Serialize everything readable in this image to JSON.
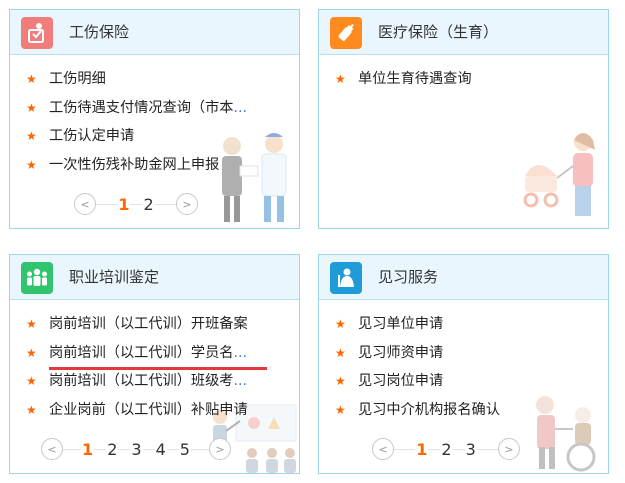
{
  "colors": {
    "panel_border": "#9ed6ea",
    "header_bg": "#eaf6fd",
    "star": "#ff6600",
    "active_page": "#ff6600",
    "link_dots": "#3b7dd8",
    "underline": "#e4393c",
    "icon_workinjury": "#f07c7c",
    "icon_medical": "#ff8a1e",
    "icon_training": "#2fc46d",
    "icon_internship": "#1f9bd7"
  },
  "panels": [
    {
      "title": "工伤保险",
      "icon": "injured-person-icon",
      "items": [
        "工伤明细",
        "工伤待遇支付情况查询（市本",
        "工伤认定申请",
        "一次性伤残补助金网上申报"
      ],
      "items_truncated": [
        false,
        true,
        false,
        false
      ],
      "pager": {
        "pages": [
          "1",
          "2"
        ],
        "active": "1",
        "prev": "<",
        "next": ">"
      }
    },
    {
      "title": "医疗保险（生育）",
      "icon": "baby-bottle-icon",
      "items": [
        "单位生育待遇查询"
      ],
      "items_truncated": [
        false
      ]
    },
    {
      "title": "职业培训鉴定",
      "icon": "group-people-icon",
      "items": [
        "岗前培训（以工代训）开班备案",
        "岗前培训（以工代训）学员名",
        "岗前培训（以工代训）班级考",
        "企业岗前（以工代训）补贴申请"
      ],
      "items_truncated": [
        false,
        true,
        true,
        false
      ],
      "highlighted_item": 1,
      "pager": {
        "pages": [
          "1",
          "2",
          "3",
          "4",
          "5"
        ],
        "active": "1",
        "prev": "<",
        "next": ">"
      }
    },
    {
      "title": "见习服务",
      "icon": "mentor-person-icon",
      "items": [
        "见习单位申请",
        "见习师资申请",
        "见习岗位申请",
        "见习中介机构报名确认"
      ],
      "items_truncated": [
        false,
        false,
        false,
        false
      ],
      "pager": {
        "pages": [
          "1",
          "2",
          "3"
        ],
        "active": "1",
        "prev": "<",
        "next": ">"
      }
    }
  ],
  "ellipsis": "..."
}
